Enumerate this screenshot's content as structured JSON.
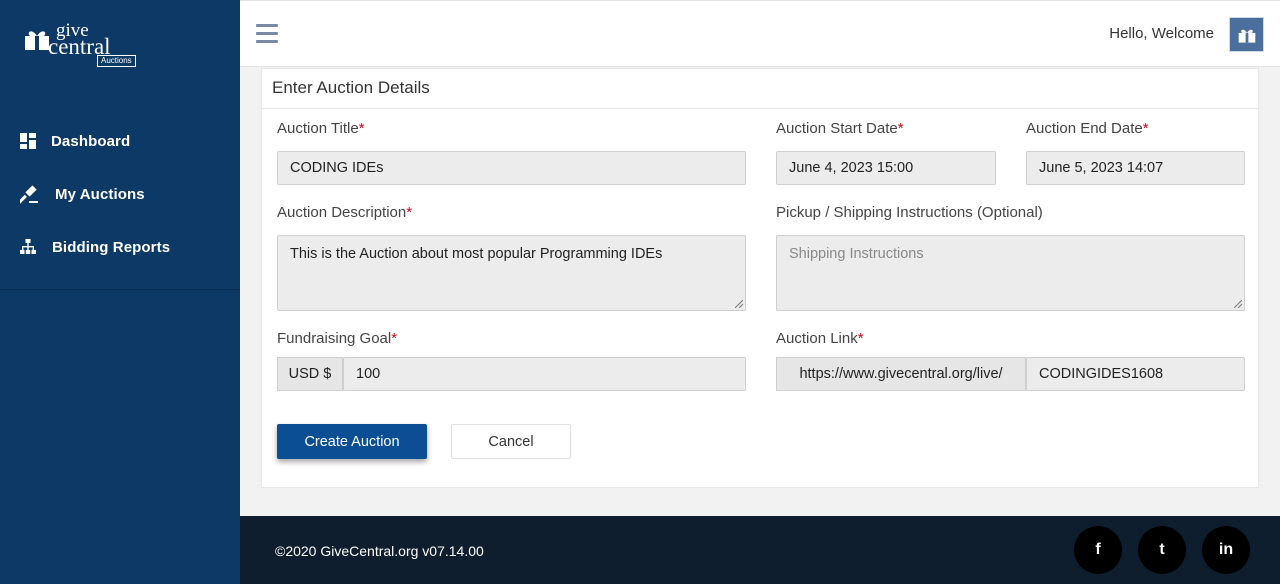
{
  "brand": {
    "give": "give",
    "central": "central",
    "tag": "Auctions"
  },
  "sidebar": {
    "items": [
      {
        "label": "Dashboard",
        "icon": "dashboard-icon"
      },
      {
        "label": "My Auctions",
        "icon": "gavel-icon"
      },
      {
        "label": "Bidding Reports",
        "icon": "sitemap-icon"
      }
    ]
  },
  "header": {
    "welcome": "Hello, Welcome"
  },
  "form": {
    "title": "Enter Auction Details",
    "auction_title": {
      "label": "Auction Title",
      "value": "CODING IDEs"
    },
    "start_date": {
      "label": "Auction Start Date",
      "value": "June 4, 2023 15:00"
    },
    "end_date": {
      "label": "Auction End Date",
      "value": "June 5, 2023 14:07"
    },
    "description": {
      "label": "Auction Description",
      "value": "This is the Auction about most popular Programming IDEs"
    },
    "shipping": {
      "label": "Pickup / Shipping Instructions (Optional)",
      "placeholder": "Shipping Instructions"
    },
    "goal": {
      "label": "Fundraising Goal",
      "currency": "USD $",
      "value": "100"
    },
    "link": {
      "label": "Auction Link",
      "prefix": "https://www.givecentral.org/live/",
      "value": "CODINGIDES1608"
    },
    "required_mark": "*",
    "create_label": "Create Auction",
    "cancel_label": "Cancel"
  },
  "footer": {
    "copyright": "©2020 GiveCentral.org v07.14.00",
    "social": [
      {
        "glyph": "f",
        "icon": "facebook-icon"
      },
      {
        "glyph": "t",
        "icon": "twitter-icon"
      },
      {
        "glyph": "in",
        "icon": "linkedin-icon"
      }
    ]
  },
  "colors": {
    "sidebar": "#0d3966",
    "primary": "#0c4e93",
    "footer": "#0f1e2e",
    "required": "#d0021b"
  }
}
